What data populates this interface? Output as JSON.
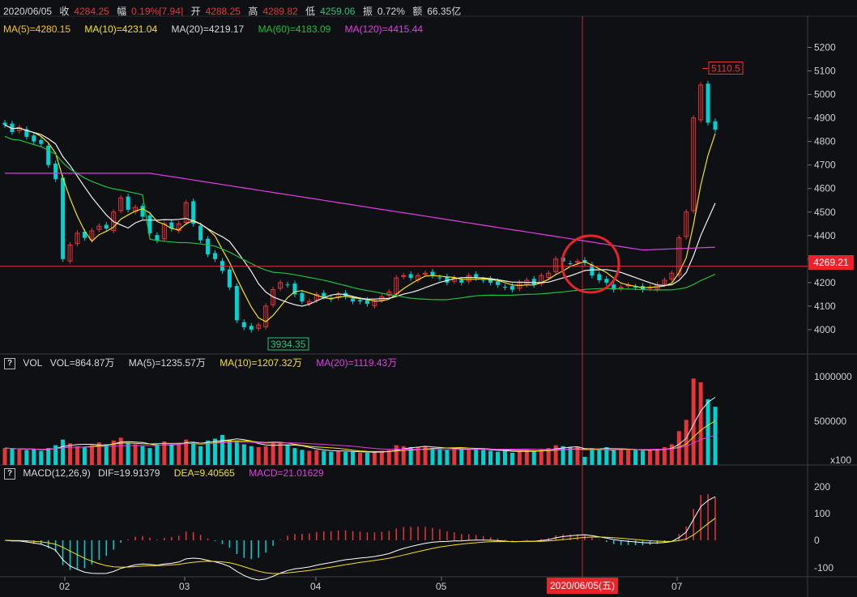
{
  "quote": {
    "date": "2020/06/05",
    "close_label": "收",
    "close": "4284.25",
    "chg_label": "幅",
    "chg": "0.19%[7.94]",
    "open_label": "开",
    "open": "4288.25",
    "high_label": "高",
    "high": "4289.82",
    "low_label": "低",
    "low": "4259.06",
    "amp_label": "振",
    "amp": "0.72%",
    "amount_label": "额",
    "amount": "66.35亿"
  },
  "ma_bar": {
    "ma5": "MA(5)=4280.15",
    "ma10": "MA(10)=4231.04",
    "ma20": "MA(20)=4219.17",
    "ma60": "MA(60)=4183.09",
    "ma120": "MA(120)=4415.44"
  },
  "vol_bar": {
    "help": "?",
    "name": "VOL",
    "vol": "VOL=864.87万",
    "ma5": "MA(5)=1235.57万",
    "ma10": "MA(10)=1207.32万",
    "ma20": "MA(20)=1119.43万"
  },
  "macd_bar": {
    "help": "?",
    "name": "MACD(12,26,9)",
    "dif": "DIF=19.91379",
    "dea": "DEA=9.40565",
    "macd": "MACD=21.01629"
  },
  "price_axis": {
    "ticks": [
      "5200",
      "5100",
      "5000",
      "4900",
      "4800",
      "4700",
      "4600",
      "4500",
      "4400",
      "4300",
      "4200",
      "4100",
      "4000"
    ],
    "current": "4269.21",
    "high_label": "5110.5",
    "low_label": "3934.35"
  },
  "vol_axis": {
    "ticks": [
      "1000000",
      "500000"
    ],
    "unit": "x100"
  },
  "macd_axis": {
    "ticks": [
      "200",
      "100",
      "0",
      "-100"
    ]
  },
  "x_axis": {
    "months": [
      "02",
      "03",
      "04",
      "05",
      "07"
    ],
    "cursor_date": "2020/06/05(五)"
  },
  "colors": {
    "up": "#e8343b",
    "down": "#00d2d2",
    "ma5": "#f2f2f2",
    "ma10": "#f3e21b",
    "ma20": "#ffffff",
    "ma60": "#1fbf3f",
    "ma120": "#e23de2",
    "bg": "#0f1014",
    "grid": "#2a2b30",
    "circle": "#e8232b"
  },
  "chart_data": {
    "type": "candlestick",
    "closes": [
      4870,
      4840,
      4860,
      4820,
      4800,
      4790,
      4700,
      4640,
      4300,
      4360,
      4410,
      4390,
      4420,
      4440,
      4430,
      4500,
      4560,
      4510,
      4520,
      4480,
      4410,
      4380,
      4450,
      4430,
      4450,
      4540,
      4450,
      4380,
      4320,
      4300,
      4250,
      4180,
      4040,
      4010,
      4000,
      4020,
      4100,
      4170,
      4200,
      4190,
      4150,
      4120,
      4120,
      4150,
      4140,
      4130,
      4150,
      4140,
      4120,
      4120,
      4110,
      4120,
      4140,
      4160,
      4220,
      4230,
      4220,
      4230,
      4240,
      4230,
      4220,
      4200,
      4220,
      4200,
      4230,
      4220,
      4210,
      4200,
      4190,
      4180,
      4170,
      4200,
      4210,
      4190,
      4230,
      4240,
      4300,
      4290,
      4280,
      4290,
      4284,
      4230,
      4210,
      4200,
      4170,
      4180,
      4190,
      4180,
      4170,
      4180,
      4190,
      4210,
      4240,
      4390,
      4500,
      4900,
      5040,
      4880,
      4850
    ],
    "volumes": [
      1800,
      1700,
      1650,
      1600,
      1700,
      1500,
      1800,
      2100,
      2700,
      2300,
      2000,
      1900,
      2100,
      2400,
      2200,
      2600,
      2900,
      2300,
      2200,
      2000,
      1800,
      2200,
      2500,
      2200,
      2300,
      2700,
      2400,
      2000,
      2600,
      2800,
      3200,
      2700,
      2600,
      2200,
      2000,
      1900,
      2000,
      2300,
      2400,
      2100,
      1800,
      1600,
      1500,
      1600,
      1500,
      1400,
      1500,
      1400,
      1400,
      1300,
      1300,
      1400,
      1500,
      1600,
      2100,
      2000,
      1900,
      1900,
      2000,
      1800,
      1700,
      1600,
      1800,
      1700,
      1600,
      1700,
      1600,
      1500,
      1400,
      1500,
      1300,
      1500,
      1600,
      1400,
      1700,
      1800,
      2100,
      2000,
      1900,
      1900,
      864,
      1800,
      1700,
      1900,
      1500,
      1600,
      1700,
      1600,
      1500,
      1600,
      1700,
      1900,
      2200,
      3600,
      4800,
      9200,
      8800,
      7000,
      6200
    ],
    "ylim_price": [
      3900,
      5250
    ],
    "ylim_vol": [
      0,
      1000000
    ],
    "ylim_macd": [
      -130,
      220
    ],
    "annotations": [
      "5110.5",
      "3934.35",
      "4269.21"
    ]
  }
}
